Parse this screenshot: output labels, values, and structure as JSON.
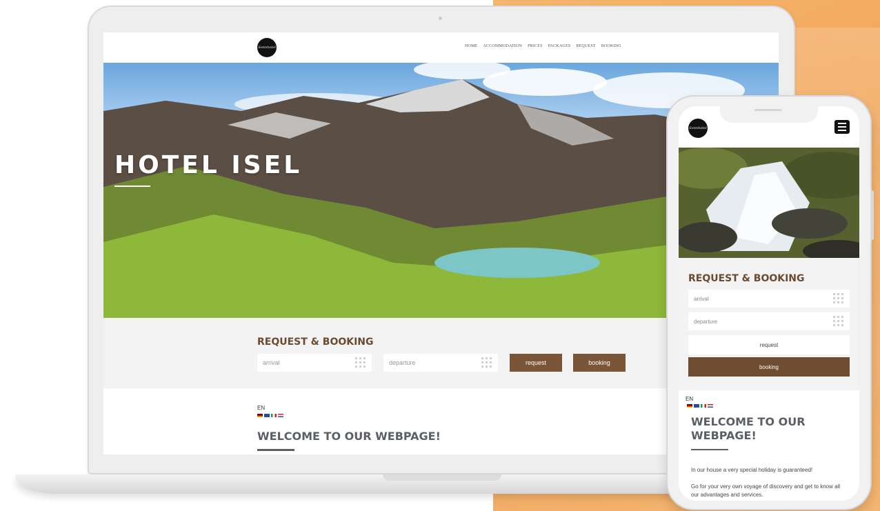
{
  "desktop": {
    "logo_text": "Sonnhotel",
    "nav": [
      "HOME",
      "ACCOMMODATION",
      "PRICES",
      "PACKAGES",
      "REQUEST",
      "BOOKING"
    ],
    "hero_title": "HOTEL ISEL",
    "booking": {
      "title": "REQUEST & BOOKING",
      "arrival_placeholder": "arrival",
      "departure_placeholder": "departure",
      "request_label": "request",
      "booking_label": "booking"
    },
    "lang": "EN",
    "welcome_title": "WELCOME TO OUR WEBPAGE!"
  },
  "mobile": {
    "logo_text": "Sonnhotel",
    "booking": {
      "title": "REQUEST & BOOKING",
      "arrival_placeholder": "arrival",
      "departure_placeholder": "departure",
      "request_label": "request",
      "booking_label": "booking"
    },
    "lang": "EN",
    "welcome_title": "WELCOME TO OUR WEBPAGE!",
    "paragraph1": "In our house a very special holiday is guaranteed!",
    "paragraph2": "Go for your very own voyage of discovery and get to know all our advantages and services."
  },
  "colors": {
    "brand_brown": "#7a5537",
    "orange_background": "#f0a458",
    "heading_gray": "#5a5f66"
  },
  "icons": [
    "calendar-icon",
    "hamburger-menu-icon",
    "flag-de-icon",
    "flag-en-icon",
    "flag-it-icon",
    "flag-nl-icon"
  ]
}
